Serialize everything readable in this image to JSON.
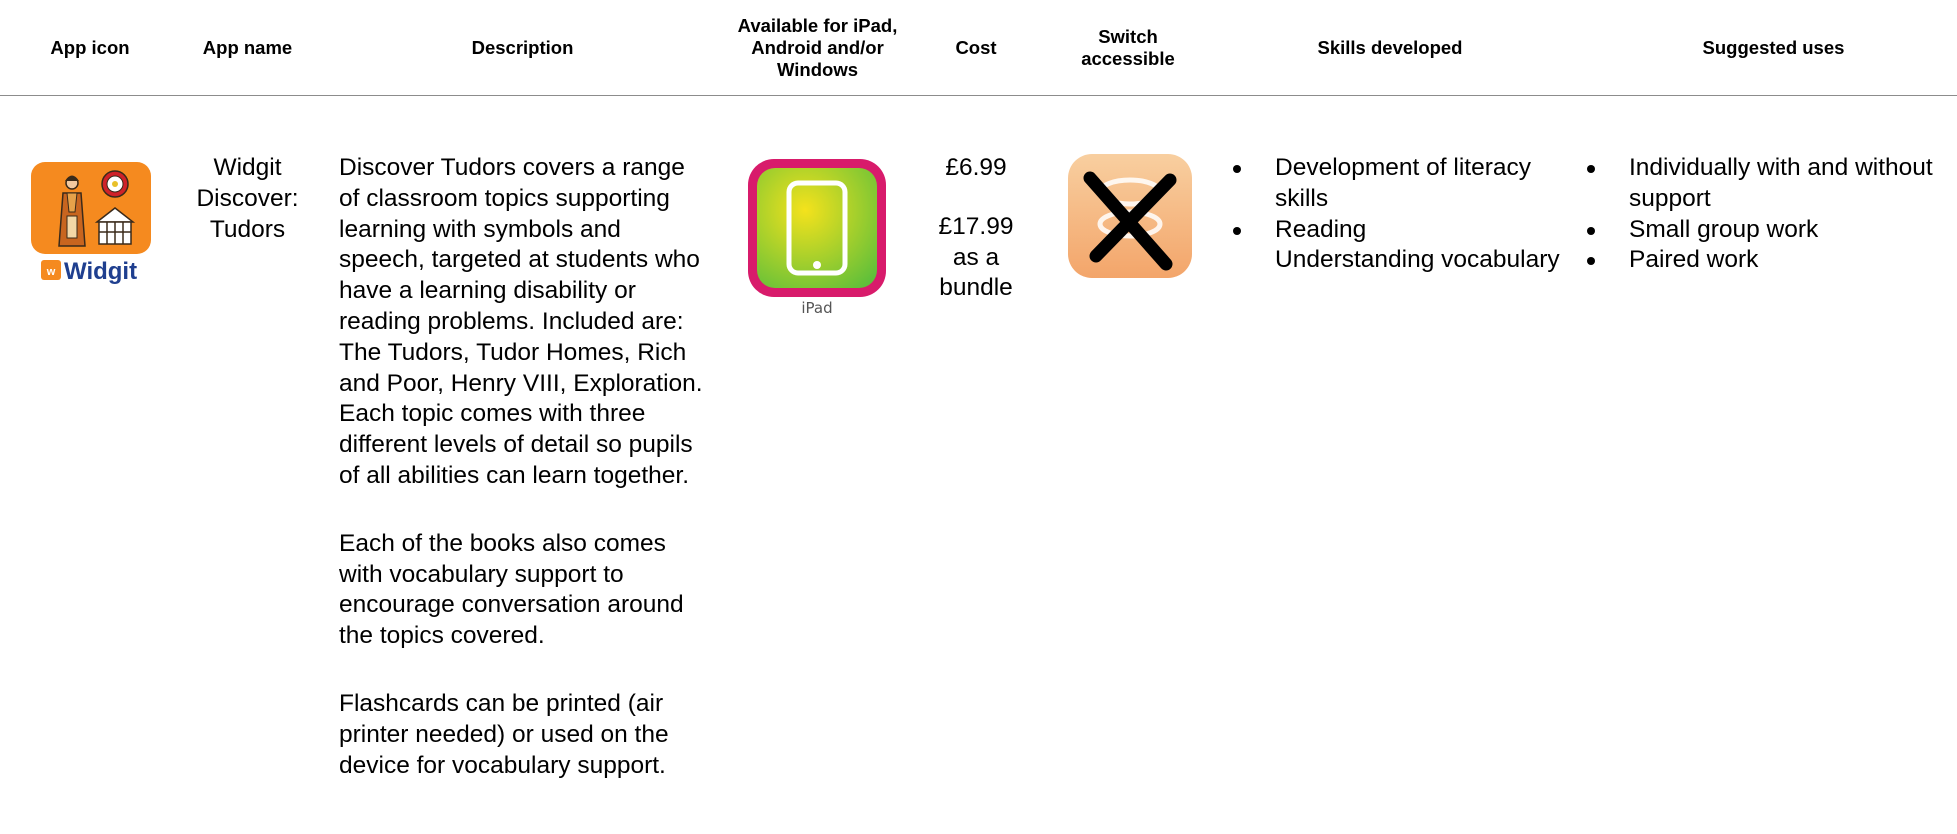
{
  "headers": {
    "app_icon": "App icon",
    "app_name": "App name",
    "description": "Description",
    "available": "Available for iPad, Android and/or Windows",
    "cost": "Cost",
    "switch": "Switch accessible",
    "skills": "Skills developed",
    "uses": "Suggested uses"
  },
  "row": {
    "icon": {
      "name": "widgit-tudors-app-icon",
      "brand_text": "Widgit",
      "brand_color": "#1f3f8f",
      "background_color": "#f58a1f"
    },
    "app_name": "Widgit Discover: Tudors",
    "description": [
      "Discover Tudors covers a range of classroom topics supporting learning with symbols and speech, targeted at students who have a learning disability or reading problems. Included are: The Tudors, Tudor Homes, Rich and Poor, Henry VIII, Exploration. Each topic comes with three different levels of detail so pupils of all abilities can learn together.",
      "Each of the books also comes with vocabulary support to encourage conversation around the topics covered.",
      "Flashcards can be printed (air printer needed) or used on the device for vocabulary support."
    ],
    "platform": {
      "icon": "ipad-icon",
      "label": "iPad",
      "frame_color": "#d81b6b",
      "screen_color": "#9bd12a"
    },
    "cost": {
      "single": "£6.99",
      "bundle_price": "£17.99",
      "bundle_line1": "as a",
      "bundle_line2": "bundle"
    },
    "switch_accessible": {
      "icon": "not-switch-accessible-cross-icon",
      "value": false
    },
    "skills": [
      {
        "text": "Development of literacy skills",
        "bullet": true
      },
      {
        "text": "Reading",
        "bullet": true
      },
      {
        "text": "Understanding vocabulary",
        "bullet": false
      }
    ],
    "uses": [
      "Individually with and without support",
      "Small group work",
      "Paired work"
    ]
  }
}
